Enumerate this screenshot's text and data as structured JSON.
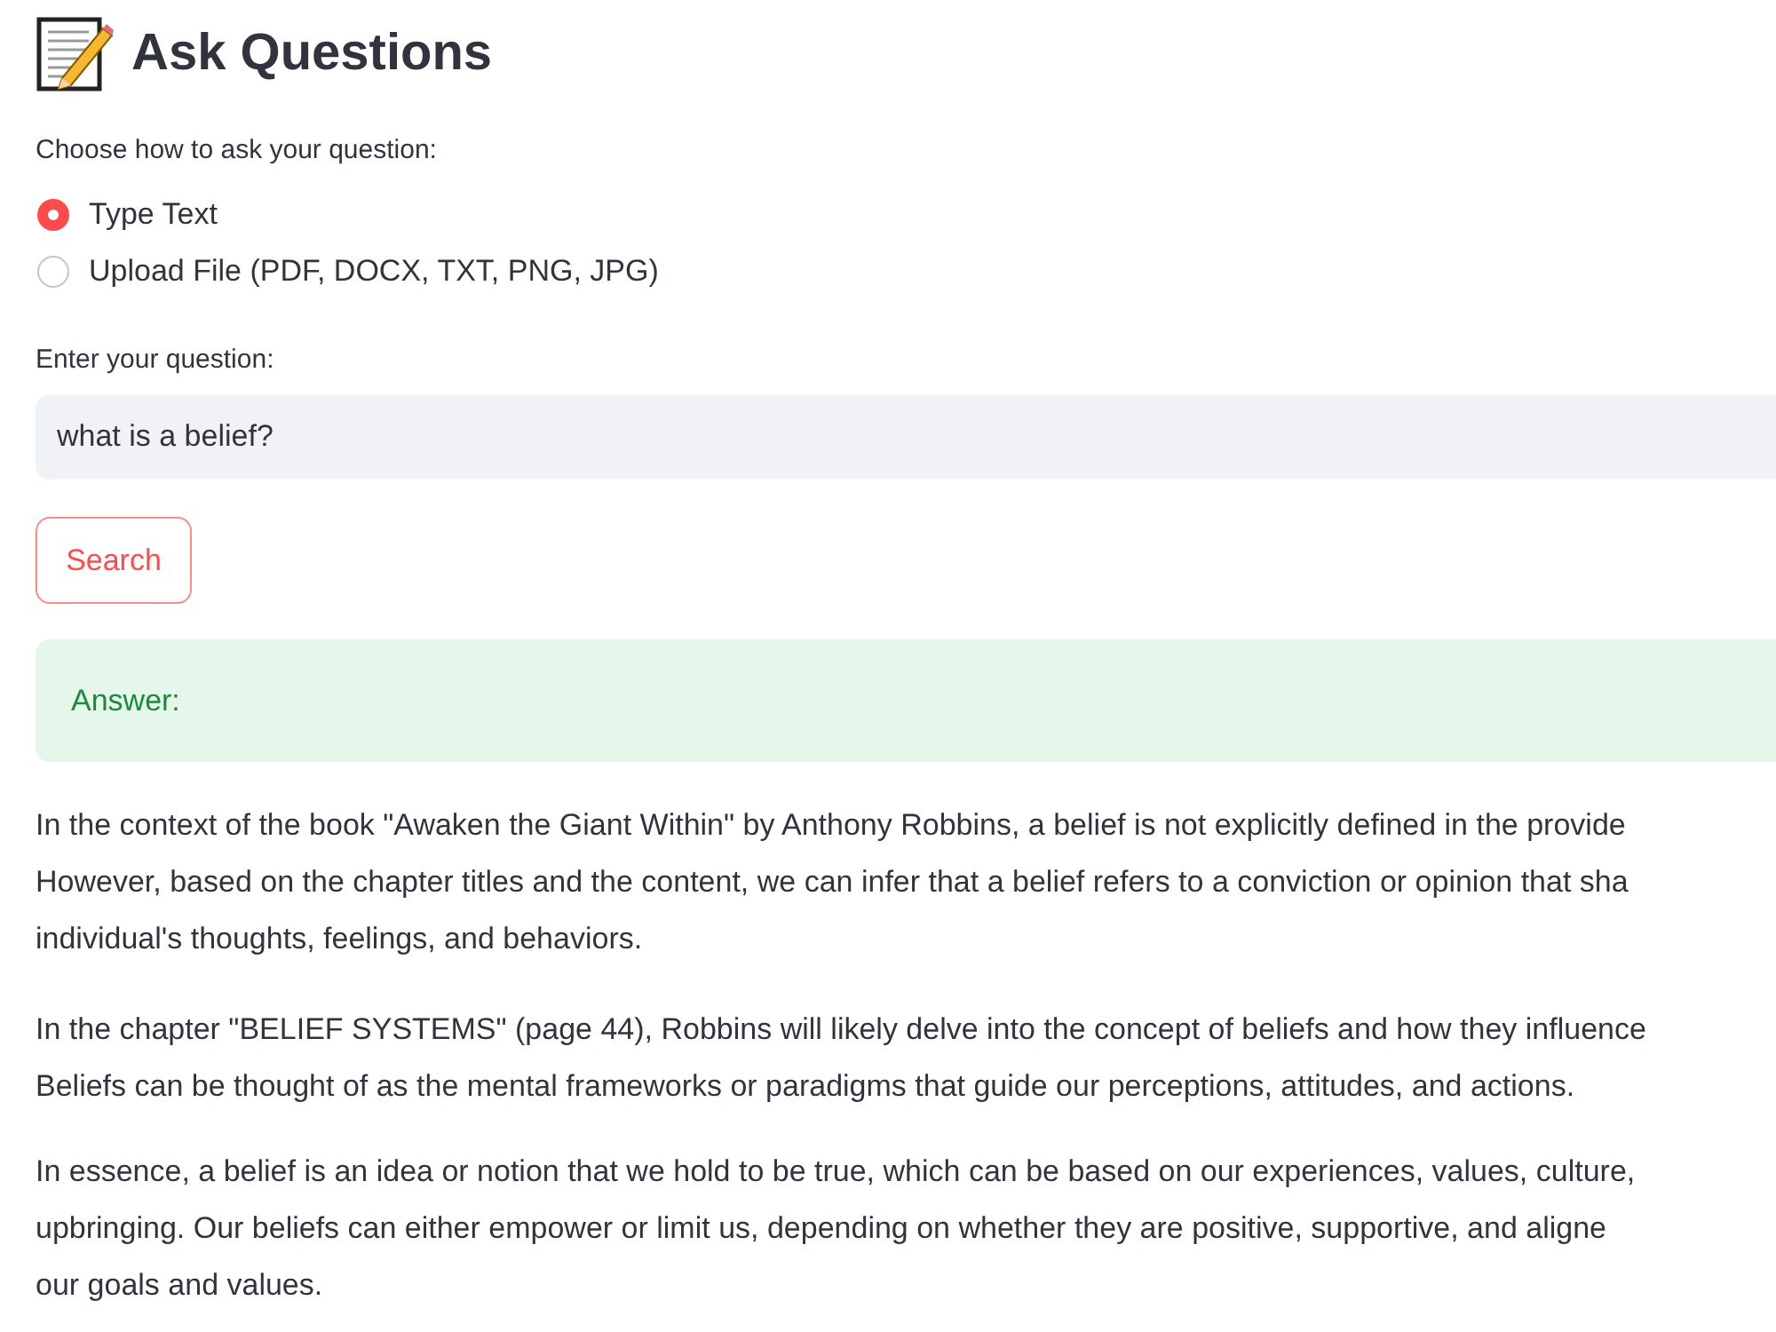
{
  "page": {
    "title": "Ask Questions"
  },
  "question_mode": {
    "label": "Choose how to ask your question:",
    "options": [
      {
        "label": "Type Text",
        "selected": true
      },
      {
        "label": "Upload File (PDF, DOCX, TXT, PNG, JPG)",
        "selected": false
      }
    ]
  },
  "question_input": {
    "label": "Enter your question:",
    "value": "what is a belief?"
  },
  "search_button": {
    "label": "Search"
  },
  "answer_alert": {
    "label": "Answer:"
  },
  "answer_paragraphs": [
    {
      "lines": [
        "In the context of the book \"Awaken the Giant Within\" by Anthony Robbins, a belief is not explicitly defined in the provide",
        "However, based on the chapter titles and the content, we can infer that a belief refers to a conviction or opinion that sha",
        "individual's thoughts, feelings, and behaviors."
      ]
    },
    {
      "lines": [
        "In the chapter \"BELIEF SYSTEMS\" (page 44), Robbins will likely delve into the concept of beliefs and how they influence",
        "Beliefs can be thought of as the mental frameworks or paradigms that guide our perceptions, attitudes, and actions."
      ]
    },
    {
      "lines": [
        "In essence, a belief is an idea or notion that we hold to be true, which can be based on our experiences, values, culture,",
        "upbringing. Our beliefs can either empower or limit us, depending on whether they are positive, supportive, and aligne",
        "our goals and values."
      ]
    }
  ]
}
